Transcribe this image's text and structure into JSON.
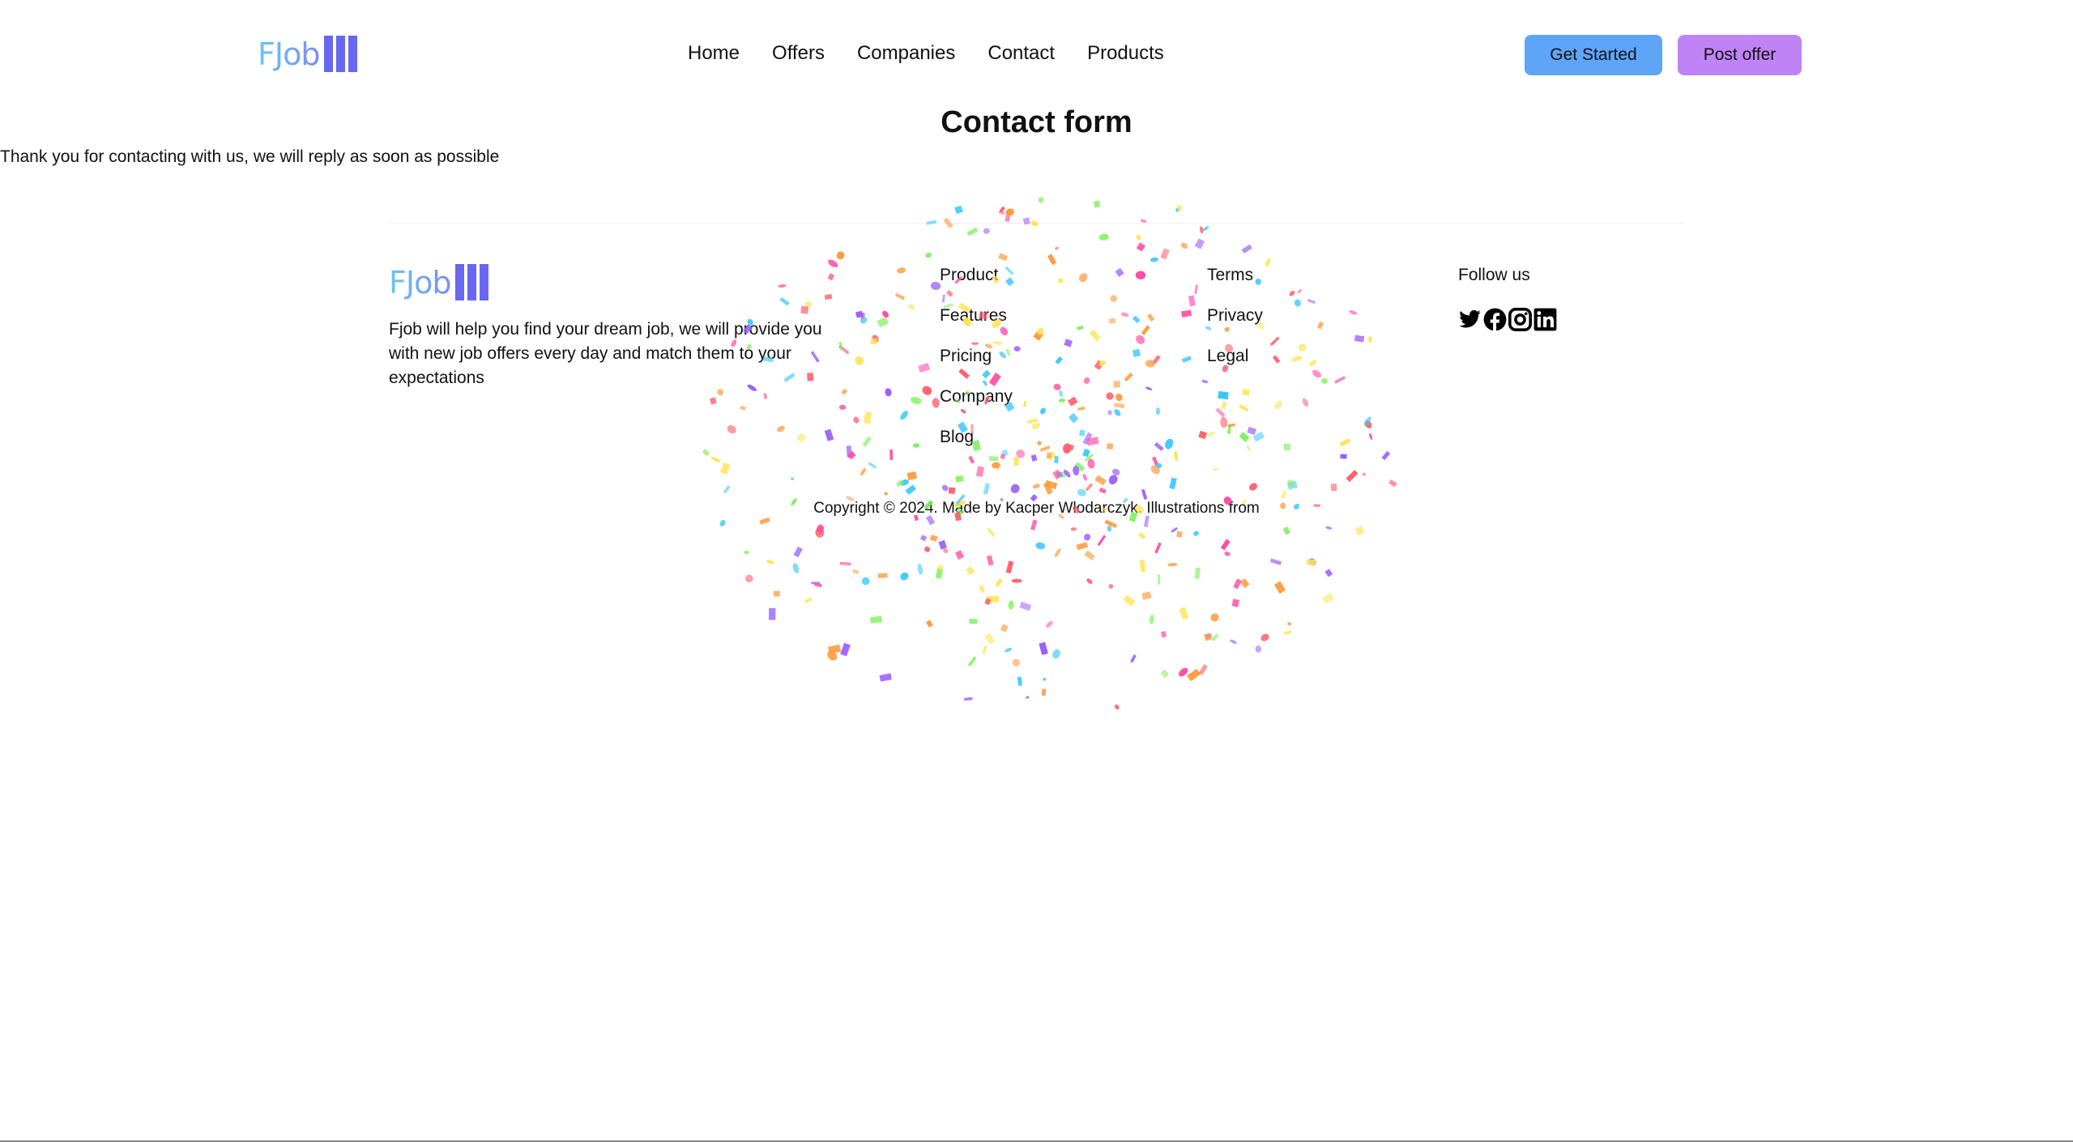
{
  "brand": {
    "name": "FJob",
    "gradient_start": "#6cc6f2",
    "gradient_end": "#7b8cf0",
    "bar_color": "#6767f0"
  },
  "nav": {
    "items": [
      "Home",
      "Offers",
      "Companies",
      "Contact",
      "Products"
    ]
  },
  "buttons": {
    "get_started": {
      "label": "Get Started",
      "color": "#5ea5f7"
    },
    "post_offer": {
      "label": "Post offer",
      "color": "#c083f6"
    }
  },
  "main": {
    "title": "Contact form",
    "message": "Thank you for contacting with us, we will reply as soon as possible"
  },
  "footer": {
    "description": "Fjob will help you find your dream job, we will provide you with new job offers every day and match them to your expectations",
    "col1": [
      "Product",
      "Features",
      "Pricing",
      "Company",
      "Blog"
    ],
    "col2": [
      "Terms",
      "Privacy",
      "Legal"
    ],
    "follow_label": "Follow us",
    "socials": [
      "twitter-icon",
      "facebook-icon",
      "instagram-icon",
      "linkedin-icon"
    ],
    "copyright": "Copyright © 2024. Made by Kacper Włodarczyk. Illustrations from"
  },
  "confetti": {
    "colors": [
      "#ff4fa3",
      "#3cc8ff",
      "#9a5cff",
      "#7cf05a",
      "#ffe34a",
      "#ff9a3c",
      "#ff5f6d"
    ]
  }
}
